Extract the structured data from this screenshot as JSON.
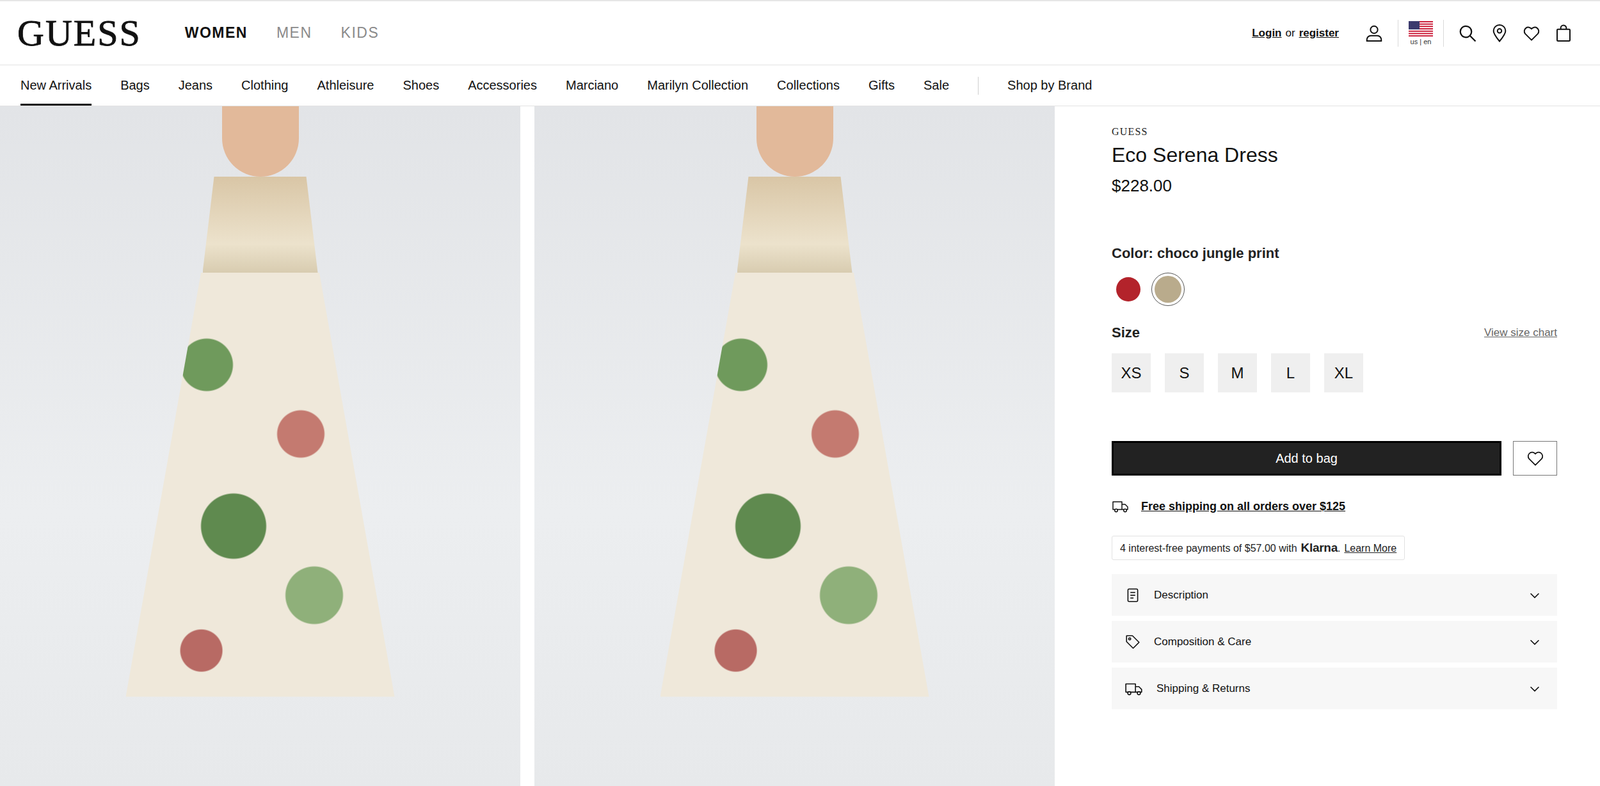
{
  "header": {
    "logo": "GUESS",
    "departments": [
      {
        "label": "WOMEN",
        "selected": true
      },
      {
        "label": "MEN",
        "selected": false
      },
      {
        "label": "KIDS",
        "selected": false
      }
    ],
    "account": {
      "login": "Login",
      "or": "or",
      "register": "register"
    },
    "locale": "us | en"
  },
  "categories": [
    {
      "label": "New Arrivals",
      "selected": true
    },
    {
      "label": "Bags",
      "selected": false
    },
    {
      "label": "Jeans",
      "selected": false
    },
    {
      "label": "Clothing",
      "selected": false
    },
    {
      "label": "Athleisure",
      "selected": false
    },
    {
      "label": "Shoes",
      "selected": false
    },
    {
      "label": "Accessories",
      "selected": false
    },
    {
      "label": "Marciano",
      "selected": false
    },
    {
      "label": "Marilyn Collection",
      "selected": false
    },
    {
      "label": "Collections",
      "selected": false
    },
    {
      "label": "Gifts",
      "selected": false
    },
    {
      "label": "Sale",
      "selected": false
    }
  ],
  "brand_link": {
    "label": "Shop by Brand",
    "selected": false
  },
  "gallery": [
    {
      "kind": "photo"
    },
    {
      "kind": "photo"
    }
  ],
  "product": {
    "brand": "GUESS",
    "title": "Eco Serena Dress",
    "price": "$228.00",
    "color_label": "Color:",
    "color_name": "choco jungle print",
    "swatches": [
      {
        "color": "#b3232b",
        "selected": false
      },
      {
        "color": "#b9ab8c",
        "selected": true
      }
    ],
    "size_label": "Size",
    "size_chart": "View size chart",
    "sizes": [
      {
        "label": "XS",
        "selected": false
      },
      {
        "label": "S",
        "selected": false
      },
      {
        "label": "M",
        "selected": false
      },
      {
        "label": "L",
        "selected": false
      },
      {
        "label": "XL",
        "selected": false
      }
    ],
    "add_to_bag": "Add to bag",
    "wishlisted": false,
    "shipping": "Free shipping on all orders over $125",
    "klarna": {
      "prefix": "4 interest-free payments of $57.00 with",
      "brand": "Klarna",
      "suffix": ".",
      "link": "Learn More"
    },
    "accordions": [
      {
        "label": "Description",
        "kind": "info",
        "expanded": false
      },
      {
        "label": "Composition & Care",
        "kind": "care",
        "expanded": false
      },
      {
        "label": "Shipping & Returns",
        "kind": "delivery",
        "expanded": false
      }
    ]
  }
}
